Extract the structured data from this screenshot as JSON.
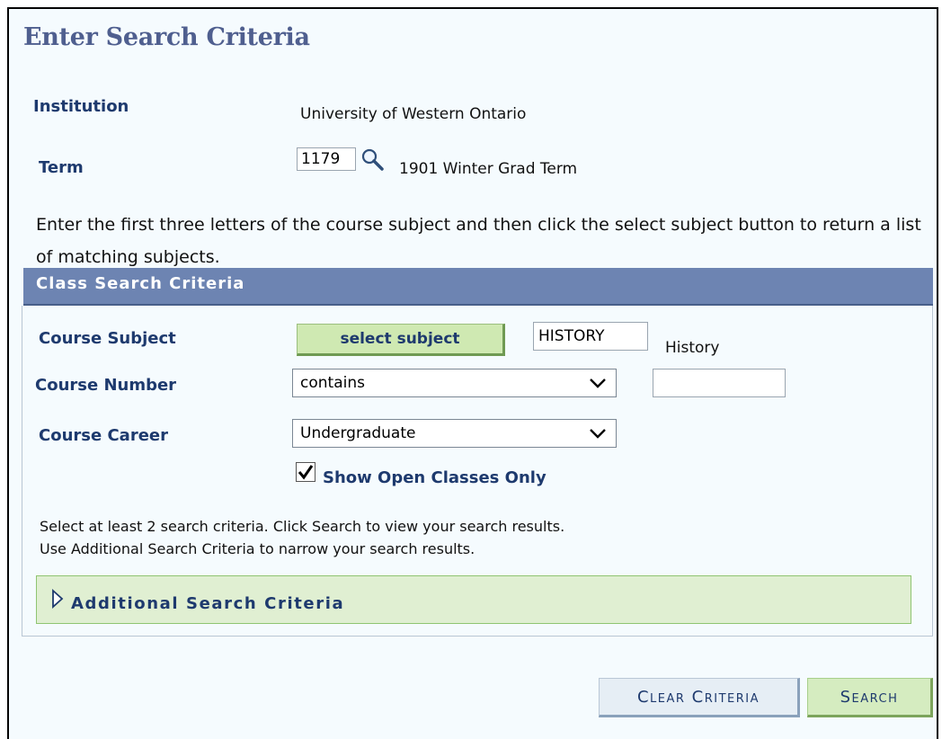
{
  "page": {
    "title": "Enter Search Criteria"
  },
  "institution": {
    "label": "Institution",
    "value": "University of Western Ontario"
  },
  "term": {
    "label": "Term",
    "code": "1179",
    "description": "1901 Winter Grad Term"
  },
  "instructions": "Enter the first three letters of the course subject and then click the select subject button to return a list of matching subjects.",
  "panel": {
    "title": "Class Search Criteria",
    "course_subject": {
      "label": "Course Subject",
      "button": "select subject",
      "value": "HISTORY",
      "description": "History"
    },
    "course_number": {
      "label": "Course Number",
      "operator": "contains",
      "value": ""
    },
    "course_career": {
      "label": "Course Career",
      "selected": "Undergraduate"
    },
    "open_classes": {
      "label": "Show Open Classes Only",
      "checked": true
    },
    "note_line1": "Select at least 2 search criteria. Click Search to view your search results.",
    "note_line2": "Use Additional Search Criteria to narrow your search results.",
    "additional": {
      "label": "Additional Search Criteria",
      "expanded": false
    }
  },
  "actions": {
    "clear": "Clear Criteria",
    "search": "Search"
  },
  "icons": {
    "lookup": "magnifier-icon",
    "dropdown": "chevron-down-icon",
    "expand": "triangle-right-icon"
  },
  "colors": {
    "title": "#4f5f8f",
    "header_bg": "#6d84b2",
    "label": "#1e3a6e",
    "green_btn": "#cfe9b2",
    "page_bg": "#f5fbfe"
  }
}
